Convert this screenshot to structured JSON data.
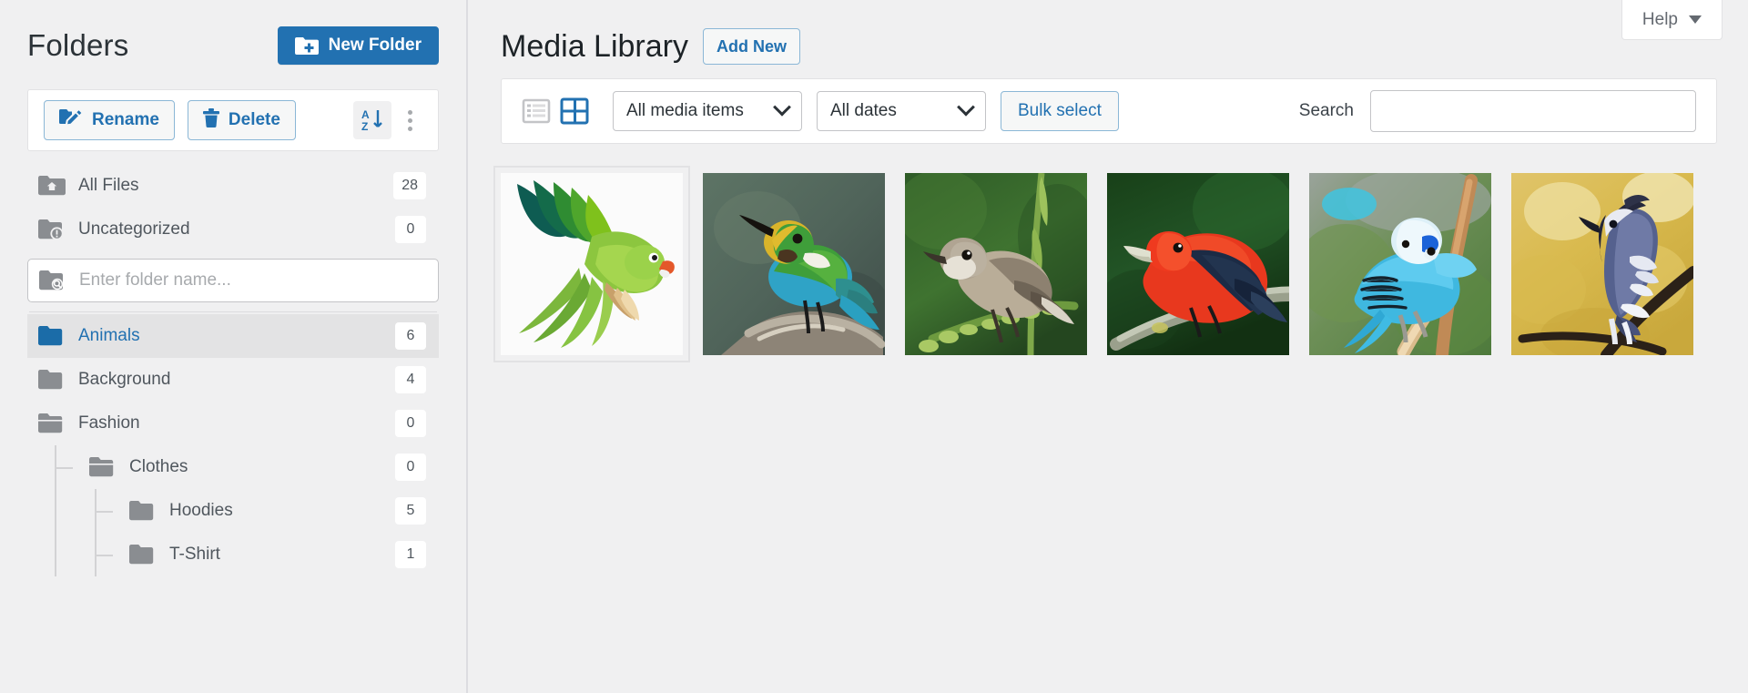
{
  "sidebar": {
    "title": "Folders",
    "new_folder_label": "New Folder",
    "rename_label": "Rename",
    "delete_label": "Delete",
    "sort_icon": "sort-az-icon",
    "more_icon": "kebab-menu-icon",
    "folder_search_placeholder": "Enter folder name...",
    "folder_search_value": "",
    "items": [
      {
        "label": "All Files",
        "count": "28",
        "level": 1,
        "icon": "folder-home-icon",
        "active": false
      },
      {
        "label": "Uncategorized",
        "count": "0",
        "level": 1,
        "icon": "folder-alert-icon",
        "active": false
      },
      {
        "label": "Animals",
        "count": "6",
        "level": 1,
        "icon": "folder-filled-icon",
        "active": true
      },
      {
        "label": "Background",
        "count": "4",
        "level": 1,
        "icon": "folder-icon",
        "active": false
      },
      {
        "label": "Fashion",
        "count": "0",
        "level": 1,
        "icon": "folder-open-icon",
        "active": false
      },
      {
        "label": "Clothes",
        "count": "0",
        "level": 2,
        "icon": "folder-open-icon",
        "active": false
      },
      {
        "label": "Hoodies",
        "count": "5",
        "level": 3,
        "icon": "folder-icon",
        "active": false
      },
      {
        "label": "T-Shirt",
        "count": "1",
        "level": 3,
        "icon": "folder-icon",
        "active": false
      }
    ]
  },
  "main": {
    "help_label": "Help",
    "title": "Media Library",
    "add_new_label": "Add New",
    "toolbar": {
      "list_view_icon": "list-view-icon",
      "grid_view_icon": "grid-view-icon",
      "media_filter_value": "All media items",
      "dates_filter_value": "All dates",
      "bulk_select_label": "Bulk select",
      "search_label": "Search",
      "search_value": "",
      "search_placeholder": ""
    },
    "items": [
      {
        "name": "green-parakeet-flying",
        "selected": true
      },
      {
        "name": "multicolored-tanager",
        "selected": false
      },
      {
        "name": "brown-warbler",
        "selected": false
      },
      {
        "name": "scarlet-tanager",
        "selected": false
      },
      {
        "name": "blue-budgerigar",
        "selected": false
      },
      {
        "name": "blue-jay",
        "selected": false
      }
    ]
  },
  "colors": {
    "accent": "#2271b1",
    "page_bg": "#f0f0f1",
    "panel_bg": "#ffffff",
    "text": "#2c3338",
    "muted": "#50575e",
    "folder_gray": "#8a8d91",
    "border": "#c3c4c7"
  }
}
